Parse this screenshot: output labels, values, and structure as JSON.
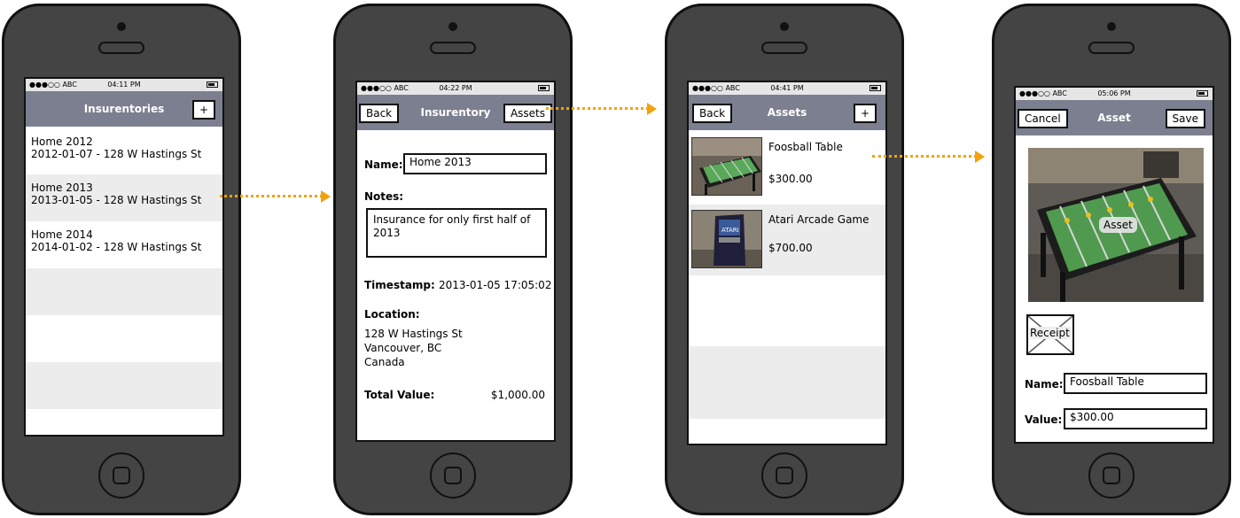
{
  "screen1": {
    "status": {
      "carrier": "●●●○○ ABC",
      "time": "04:11 PM"
    },
    "title": "Insurentories",
    "add_label": "+",
    "items": [
      {
        "name": "Home 2012",
        "detail": "2012-01-07 - 128 W Hastings St"
      },
      {
        "name": "Home 2013",
        "detail": "2013-01-05 - 128 W Hastings St"
      },
      {
        "name": "Home 2014",
        "detail": "2014-01-02 - 128 W Hastings St"
      }
    ]
  },
  "screen2": {
    "status": {
      "carrier": "●●●○○ ABC",
      "time": "04:22 PM"
    },
    "back_label": "Back",
    "title": "Insurentory",
    "assets_label": "Assets",
    "name_label": "Name:",
    "name_value": "Home 2013",
    "notes_label": "Notes:",
    "notes_value": "Insurance for only first half of 2013",
    "timestamp_label": "Timestamp:",
    "timestamp_value": "2013-01-05 17:05:02",
    "location_label": "Location:",
    "location_lines": [
      "128 W Hastings St",
      "Vancouver, BC",
      "Canada"
    ],
    "total_label": "Total Value:",
    "total_value": "$1,000.00"
  },
  "screen3": {
    "status": {
      "carrier": "●●●○○ ABC",
      "time": "04:41 PM"
    },
    "back_label": "Back",
    "title": "Assets",
    "add_label": "+",
    "items": [
      {
        "name": "Foosball Table",
        "price": "$300.00"
      },
      {
        "name": "Atari Arcade Game",
        "price": "$700.00"
      }
    ]
  },
  "screen4": {
    "status": {
      "carrier": "●●●○○ ABC",
      "time": "05:06 PM"
    },
    "cancel_label": "Cancel",
    "title": "Asset",
    "save_label": "Save",
    "photo_caption": "Asset",
    "receipt_label": "Receipt",
    "name_label": "Name:",
    "name_value": "Foosball Table",
    "value_label": "Value:",
    "value_value": "$300.00"
  },
  "colors": {
    "navbar": "#7b7f8f",
    "phone_body": "#444444",
    "arrow": "#f2a20c",
    "alt_row": "#ececec"
  }
}
